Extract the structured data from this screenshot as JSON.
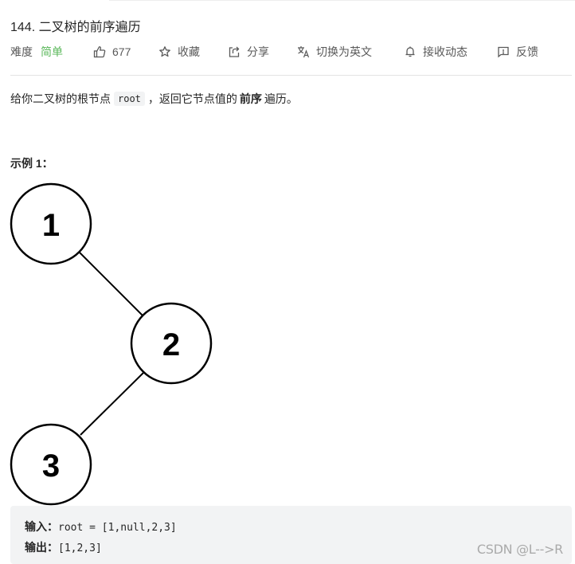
{
  "problem": {
    "title": "144. 二叉树的前序遍历",
    "difficulty_label": "难度",
    "difficulty_value": "简单",
    "difficulty_color": "#5cb85c",
    "actions": [
      {
        "icon": "thumbs-up-icon",
        "label": "677"
      },
      {
        "icon": "star-icon",
        "label": "收藏"
      },
      {
        "icon": "share-icon",
        "label": "分享"
      },
      {
        "icon": "translate-icon",
        "label": "切换为英文"
      },
      {
        "icon": "bell-icon",
        "label": "接收动态"
      },
      {
        "icon": "feedback-icon",
        "label": "反馈"
      }
    ]
  },
  "description": {
    "prefix": "给你二叉树的根节点",
    "code": "root",
    "middle": "，返回它节点值的",
    "bold": "前序",
    "suffix": "遍历。"
  },
  "example": {
    "title": "示例 1：",
    "tree_nodes": [
      "1",
      "2",
      "3"
    ],
    "input_label": "输入：",
    "input_value": "root = [1,null,2,3]",
    "output_label": "输出：",
    "output_value": "[1,2,3]"
  },
  "watermark": "CSDN @L-->R"
}
